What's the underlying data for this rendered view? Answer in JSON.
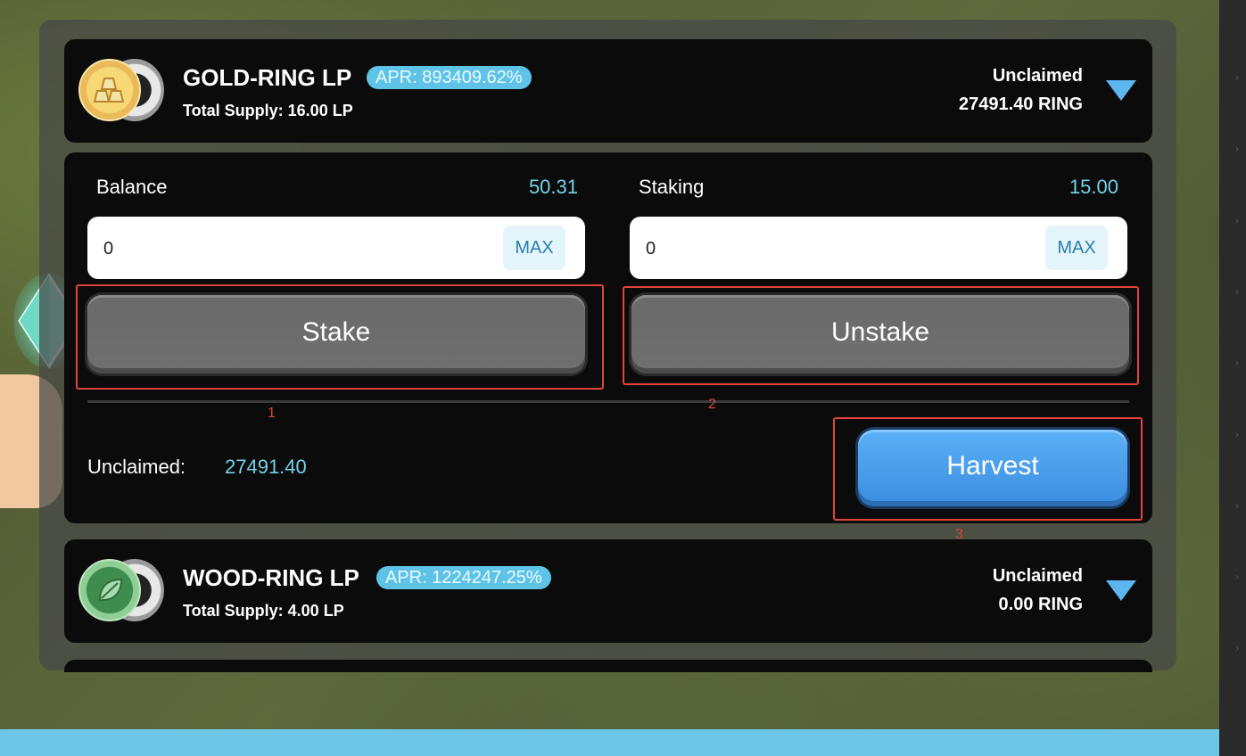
{
  "farms": [
    {
      "name": "GOLD-RING LP",
      "apr": "APR: 893409.62%",
      "total_supply": "Total Supply: 16.00 LP",
      "unclaimed_label": "Unclaimed",
      "unclaimed_value": "27491.40 RING",
      "icon": "gold-bars-icon"
    },
    {
      "name": "WOOD-RING LP",
      "apr": "APR: 1224247.25%",
      "total_supply": "Total Supply: 4.00 LP",
      "unclaimed_label": "Unclaimed",
      "unclaimed_value": "0.00 RING",
      "icon": "leaf-icon"
    }
  ],
  "detail": {
    "balance_label": "Balance",
    "balance_value": "50.31",
    "staking_label": "Staking",
    "staking_value": "15.00",
    "stake_input_value": "0",
    "unstake_input_value": "0",
    "max_label": "MAX",
    "stake_button": "Stake",
    "unstake_button": "Unstake",
    "unclaimed_label": "Unclaimed:",
    "unclaimed_value": "27491.40",
    "harvest_button": "Harvest"
  },
  "annotations": [
    "1",
    "2",
    "3"
  ],
  "colors": {
    "accent": "#74d2e8",
    "apr_badge": "#5fc3e8",
    "harvest_blue": "#3b8de0",
    "annotation_red": "#e0443a"
  }
}
